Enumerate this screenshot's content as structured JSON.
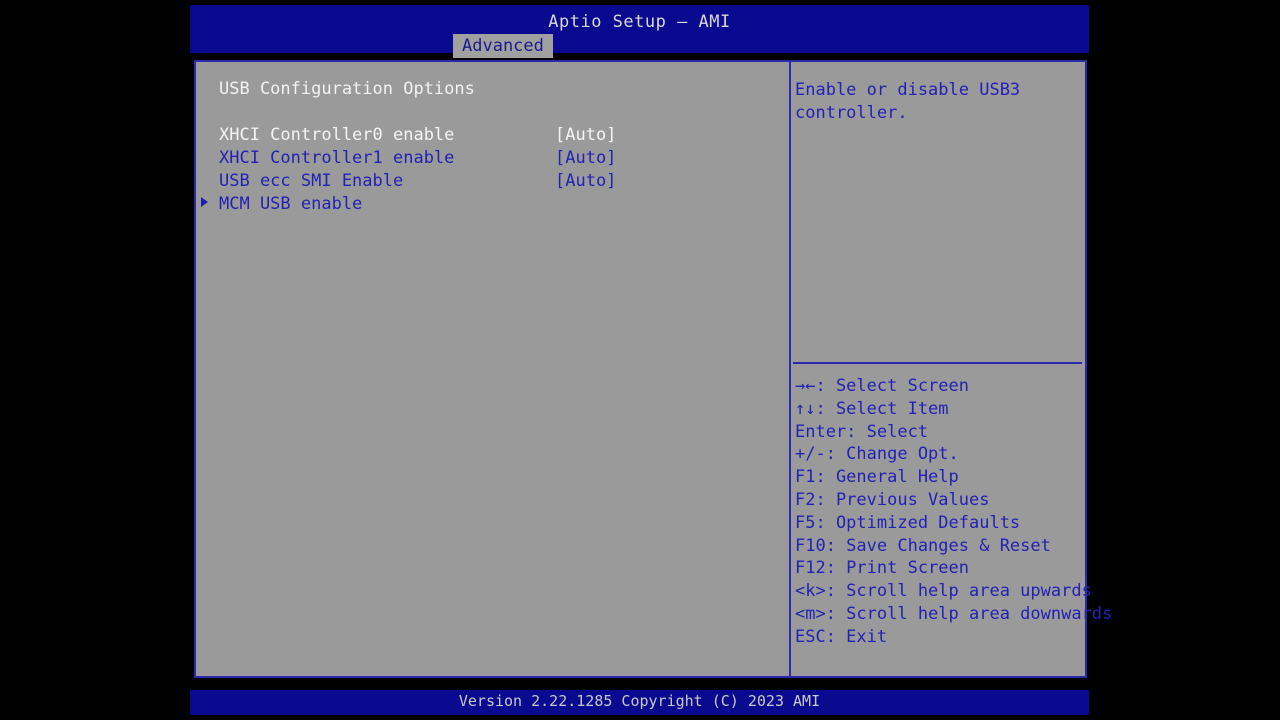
{
  "colors": {
    "header_blue": "#0a0a91",
    "body_gray": "#9a9a9a",
    "text_blue": "#2222b4",
    "text_white": "#f4f4f4",
    "border_blue": "#2a2aa8",
    "tab_bg": "#a0a0a0",
    "screen_black": "#000000"
  },
  "header": {
    "title": "Aptio Setup – AMI",
    "tabs": [
      {
        "label": "Advanced",
        "active": true
      }
    ]
  },
  "main": {
    "section_title": "USB Configuration Options",
    "options": [
      {
        "label": "XHCI Controller0 enable",
        "value": "[Auto]",
        "selected": true,
        "submenu": false
      },
      {
        "label": "XHCI Controller1 enable",
        "value": "[Auto]",
        "selected": false,
        "submenu": false
      },
      {
        "label": "USB ecc SMI Enable",
        "value": "[Auto]",
        "selected": false,
        "submenu": false
      },
      {
        "label": "MCM USB enable",
        "value": "",
        "selected": false,
        "submenu": true
      }
    ]
  },
  "help": {
    "text": "Enable or disable USB3 controller.",
    "legend": [
      "→←: Select Screen",
      "↑↓: Select Item",
      "Enter: Select",
      "+/-: Change Opt.",
      "F1: General Help",
      "F2: Previous Values",
      "F5: Optimized Defaults",
      "F10: Save Changes & Reset",
      "F12: Print Screen",
      "<k>: Scroll help area upwards",
      "<m>: Scroll help area downwards",
      "ESC: Exit"
    ]
  },
  "footer": {
    "text": "Version 2.22.1285 Copyright (C) 2023 AMI"
  },
  "icons": {
    "submenu_arrow": "triangle-right-icon"
  }
}
